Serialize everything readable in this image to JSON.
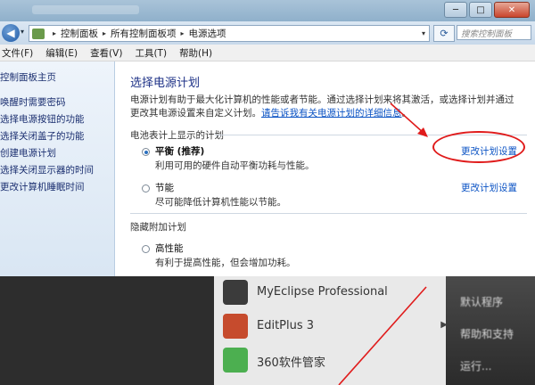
{
  "window": {
    "minimize": "─",
    "maximize": "□",
    "close": "✕"
  },
  "address": {
    "crumbs": [
      "控制面板",
      "所有控制面板项",
      "电源选项"
    ],
    "search_placeholder": "搜索控制面板"
  },
  "menubar": [
    "文件(F)",
    "编辑(E)",
    "查看(V)",
    "工具(T)",
    "帮助(H)"
  ],
  "leftpane": {
    "links": [
      "控制面板主页",
      "唤醒时需要密码",
      "选择电源按钮的功能",
      "选择关闭盖子的功能",
      "创建电源计划",
      "选择关闭显示器的时间",
      "更改计算机睡眠时间"
    ]
  },
  "main": {
    "heading": "选择电源计划",
    "desc_text": "电源计划有助于最大化计算机的性能或者节能。通过选择计划来将其激活，或选择计划并通过更改其电源设置来自定义计划。",
    "desc_link": "请告诉我有关电源计划的详细信息",
    "desc_end": "。",
    "section_battery": "电池表计上显示的计划",
    "section_hidden": "隐藏附加计划",
    "plans": [
      {
        "name": "平衡 (推荐)",
        "desc": "利用可用的硬件自动平衡功耗与性能。",
        "change": "更改计划设置",
        "selected": true
      },
      {
        "name": "节能",
        "desc": "尽可能降低计算机性能以节能。",
        "change": "更改计划设置",
        "selected": false
      },
      {
        "name": "高性能",
        "desc": "有利于提高性能，但会增加功耗。",
        "selected": false
      }
    ]
  },
  "startmenu": {
    "programs": [
      {
        "name": "MyEclipse Professional",
        "color": "#3b3b3b"
      },
      {
        "name": "EditPlus 3",
        "color": "#c64b2d"
      },
      {
        "name": "360软件管家",
        "color": "#4caf50"
      }
    ],
    "right_items": [
      "默认程序",
      "帮助和支持",
      "运行..."
    ]
  },
  "annotation_color": "#e01b1b"
}
